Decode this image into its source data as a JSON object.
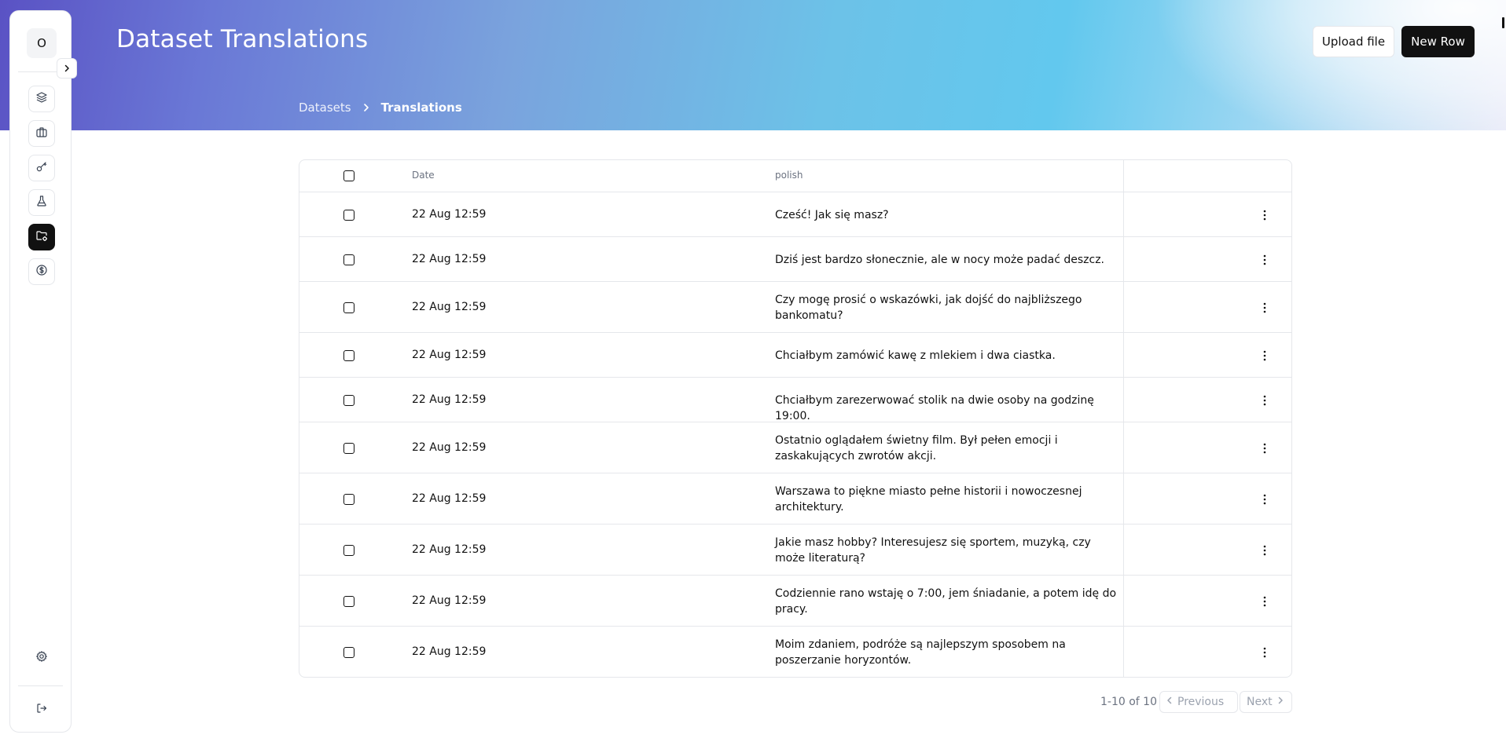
{
  "header": {
    "title": "Dataset Translations",
    "upload_label": "Upload file",
    "new_row_label": "New Row"
  },
  "breadcrumb": {
    "parent": "Datasets",
    "current": "Translations"
  },
  "sidebar": {
    "avatar_initial": "O",
    "items": [
      {
        "icon": "layers-icon"
      },
      {
        "icon": "briefcase-icon"
      },
      {
        "icon": "key-icon"
      },
      {
        "icon": "flask-icon"
      },
      {
        "icon": "folder-settings-icon",
        "active": true
      },
      {
        "icon": "dollar-circle-icon"
      }
    ],
    "bottom": [
      {
        "icon": "gear-icon"
      },
      {
        "icon": "logout-icon"
      }
    ]
  },
  "table": {
    "columns": {
      "date": "Date",
      "polish": "polish"
    },
    "rows": [
      {
        "date": "22 Aug 12:59",
        "polish": "Cześć! Jak się masz?"
      },
      {
        "date": "22 Aug 12:59",
        "polish": "Dziś jest bardzo słonecznie, ale w nocy może padać deszcz."
      },
      {
        "date": "22 Aug 12:59",
        "polish": "Czy mogę prosić o wskazówki, jak dojść do najbliższego bankomatu?"
      },
      {
        "date": "22 Aug 12:59",
        "polish": "Chciałbym zamówić kawę z mlekiem i dwa ciastka."
      },
      {
        "date": "22 Aug 12:59",
        "polish": "Chciałbym zarezerwować stolik na dwie osoby na godzinę 19:00."
      },
      {
        "date": "22 Aug 12:59",
        "polish": "Ostatnio oglądałem świetny film. Był pełen emocji i zaskakujących zwrotów akcji."
      },
      {
        "date": "22 Aug 12:59",
        "polish": "Warszawa to piękne miasto pełne historii i nowoczesnej architektury."
      },
      {
        "date": "22 Aug 12:59",
        "polish": "Jakie masz hobby? Interesujesz się sportem, muzyką, czy może literaturą?"
      },
      {
        "date": "22 Aug 12:59",
        "polish": "Codziennie rano wstaję o 7:00, jem śniadanie, a potem idę do pracy."
      },
      {
        "date": "22 Aug 12:59",
        "polish": "Moim zdaniem, podróże są najlepszym sposobem na poszerzanie horyzontów."
      }
    ]
  },
  "pagination": {
    "summary": "1-10 of 10",
    "previous_label": "Previous",
    "next_label": "Next"
  },
  "colors": {
    "primary_button": "#111111",
    "border": "#e5e7eb",
    "muted_text": "#6b7280"
  }
}
